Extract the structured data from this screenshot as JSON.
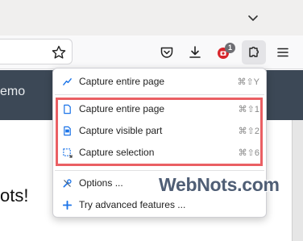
{
  "toolbar": {
    "icons": [
      "chevron-down-icon",
      "star-icon",
      "pocket-icon",
      "download-icon",
      "extension-badge-icon",
      "extensions-puzzle-icon",
      "hamburger-menu-icon"
    ],
    "badge_count": "1"
  },
  "page": {
    "nav_text": "emo",
    "hero_text": "ots!"
  },
  "menu": {
    "items": [
      {
        "label": "Capture entire page",
        "shortcut": "⌘⇧Y",
        "icon": "capture-page-icon"
      },
      {
        "label": "Capture entire page",
        "shortcut": "⌘⇧1",
        "icon": "document-icon"
      },
      {
        "label": "Capture visible part",
        "shortcut": "⌘⇧2",
        "icon": "visible-part-icon"
      },
      {
        "label": "Capture selection",
        "shortcut": "⌘⇧6",
        "icon": "selection-icon"
      },
      {
        "label": "Options ...",
        "shortcut": "",
        "icon": "tools-icon"
      },
      {
        "label": "Try advanced features ...",
        "shortcut": "",
        "icon": "plus-icon"
      }
    ],
    "highlight_color": "#ea5f63"
  },
  "watermark": "WebNots.com",
  "colors": {
    "accent_blue": "#1a73e8",
    "nav_bg": "#3c4856"
  }
}
